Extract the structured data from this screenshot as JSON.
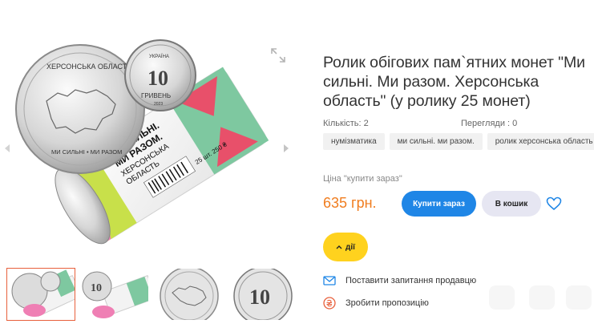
{
  "gallery": {
    "main_coin": {
      "region": "ХЕРСОНСЬКА ОБЛАСТЬ",
      "motto": "МИ СИЛЬНІ • МИ РАЗОМ"
    },
    "small_coin": {
      "country": "УКРАЇНА",
      "denomination": "10",
      "currency": "ГРИВЕНЬ",
      "year": "2023"
    },
    "roll_label": {
      "line1": "МИ СИЛЬНІ.",
      "line2": "МИ РАЗОМ.",
      "line3": "ХЕРСОНСЬКА",
      "line4": "ОБЛАСТЬ",
      "count": "25 шт. 250 ₴"
    },
    "thumbnail_count": 4,
    "active_thumbnail": 1
  },
  "product": {
    "title": "Ролик обігових пам`ятних монет \"Ми сильні. Ми разом. Херсонська область\" (у ролику 25 монет)",
    "quantity": "Кількість: 2",
    "views": "Перегляди : 0",
    "tags": [
      "нумізматика",
      "ми сильні. ми разом.",
      "ролик херсонська область"
    ],
    "price_label": "Ціна \"купити зараз\"",
    "price": "635 грн.",
    "buy_now": "Купити зараз",
    "add_to_cart": "В кошик",
    "actions": "дії",
    "ask_seller": "Поставити запитання продавцю",
    "make_offer": "Зробити пропозицію"
  },
  "colors": {
    "accent_blue": "#1f86e6",
    "price_orange": "#f07d1f",
    "actions_yellow": "#ffd21e",
    "cart_lavender": "#e6e6f2",
    "offer_red": "#e8603c"
  }
}
